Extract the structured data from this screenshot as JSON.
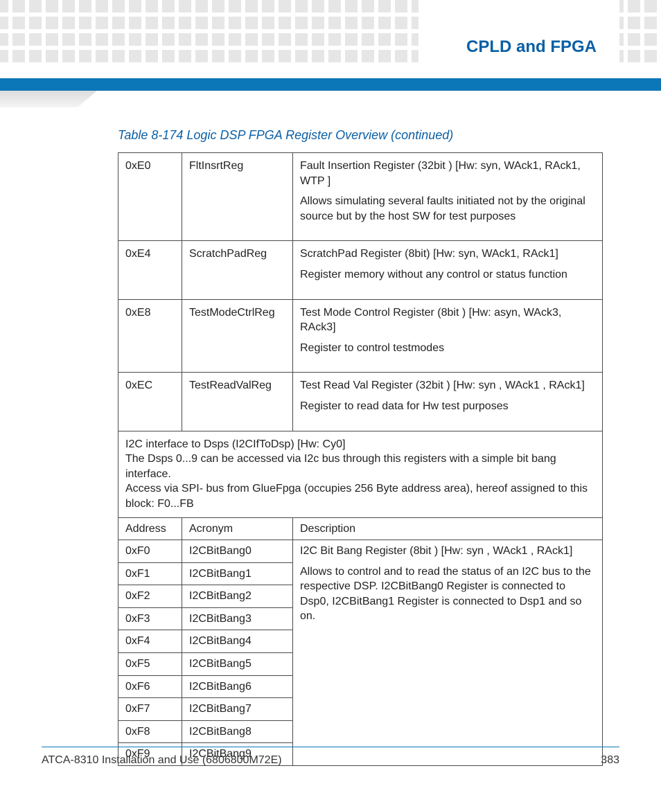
{
  "header": {
    "section_title": "CPLD and FPGA"
  },
  "table_caption": "Table 8-174 Logic DSP FPGA Register Overview (continued)",
  "rows_top": [
    {
      "addr": "0xE0",
      "acr": "FltInsrtReg",
      "desc": [
        "Fault Insertion Register (32bit ) [Hw: syn, WAck1, RAck1, WTP ]",
        "Allows simulating several faults initiated not by the original source but by the host SW for test purposes"
      ]
    },
    {
      "addr": "0xE4",
      "acr": "ScratchPadReg",
      "desc": [
        "ScratchPad Register (8bit) [Hw: syn, WAck1, RAck1]",
        "Register memory without any control or status function"
      ]
    },
    {
      "addr": "0xE8",
      "acr": "TestModeCtrlReg",
      "desc": [
        "Test Mode Control Register (8bit ) [Hw: asyn, WAck3, RAck3]",
        "Register to control testmodes"
      ]
    },
    {
      "addr": "0xEC",
      "acr": "TestReadValReg",
      "desc": [
        "Test Read Val Register (32bit ) [Hw: syn , WAck1 , RAck1]",
        "Register to read data for Hw test purposes"
      ]
    }
  ],
  "section_note": [
    "I2C interface to Dsps (I2CIfToDsp) [Hw: Cy0]",
    "The Dsps 0...9 can be accessed via I2c bus through this registers with a simple bit bang interface.",
    "Access via SPI- bus from GlueFpga (occupies 256 Byte address area), hereof assigned to this block: F0...FB"
  ],
  "subheaders": {
    "c0": "Address",
    "c1": "Acronym",
    "c2": "Description"
  },
  "bitbang": {
    "desc": [
      "I2C Bit Bang Register (8bit ) [Hw: syn , WAck1 , RAck1]",
      "Allows to control and to read the status of an I2C bus to the respective DSP. I2CBitBang0 Register is connected to Dsp0, I2CBitBang1 Register is connected to Dsp1 and so on."
    ],
    "rows": [
      {
        "addr": "0xF0",
        "acr": "I2CBitBang0"
      },
      {
        "addr": "0xF1",
        "acr": "I2CBitBang1"
      },
      {
        "addr": "0xF2",
        "acr": "I2CBitBang2"
      },
      {
        "addr": "0xF3",
        "acr": "I2CBitBang3"
      },
      {
        "addr": "0xF4",
        "acr": "I2CBitBang4"
      },
      {
        "addr": "0xF5",
        "acr": "I2CBitBang5"
      },
      {
        "addr": "0xF6",
        "acr": "I2CBitBang6"
      },
      {
        "addr": "0xF7",
        "acr": "I2CBitBang7"
      },
      {
        "addr": "0xF8",
        "acr": "I2CBitBang8"
      },
      {
        "addr": "0xF9",
        "acr": "I2CBitBang9"
      }
    ]
  },
  "footer": {
    "doc": "ATCA-8310 Installation and Use (6806800M72E)",
    "page": "383"
  }
}
